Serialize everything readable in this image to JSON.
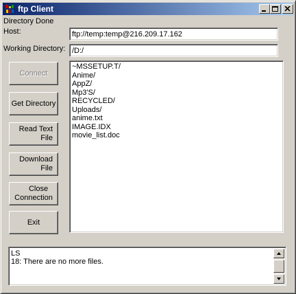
{
  "window": {
    "title": "ftp Client",
    "status": "Directory Done"
  },
  "host": {
    "label": "Host:",
    "value": "ftp://temp:temp@216.209.17.162"
  },
  "working_directory": {
    "label": "Working Directory:",
    "value": "/D:/"
  },
  "buttons": {
    "connect": "Connect",
    "get_directory": "Get Directory",
    "read_text_file_1": "Read Text",
    "read_text_file_2": "File",
    "download_file_1": "Download",
    "download_file_2": "File",
    "close_connection_1": "Close",
    "close_connection_2": "Connection",
    "exit": "Exit"
  },
  "listing": [
    "~MSSETUP.T/",
    "Anime/",
    "AppZ/",
    "Mp3'S/",
    "RECYCLED/",
    "Uploads/",
    "anime.txt",
    "IMAGE.IDX",
    "movie_list.doc"
  ],
  "log": {
    "line1": "LS",
    "line2": "18: There are no more files."
  }
}
